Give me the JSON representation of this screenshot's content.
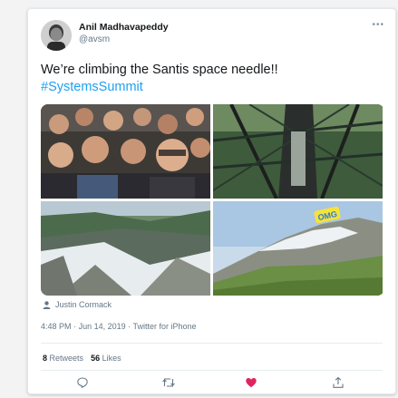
{
  "user": {
    "name": "Anil Madhavapeddy",
    "handle": "@avsm"
  },
  "menu_icon": "ellipsis-icon",
  "tweet": {
    "text": "We’re climbing the Santis space needle!!",
    "hashtag": "#SystemsSummit"
  },
  "media": {
    "items": [
      {
        "subject": "group selfie of people"
      },
      {
        "subject": "steel tower lattice interior"
      },
      {
        "subject": "snowy mountain valley"
      },
      {
        "subject": "mountain ridge",
        "overlay_text": "OMG"
      }
    ]
  },
  "photo_credit": {
    "icon": "person-icon",
    "name": "Justin Cormack"
  },
  "meta": {
    "time": "4:48 PM",
    "date": "Jun 14, 2019",
    "source": "Twitter for iPhone",
    "separator": "·"
  },
  "stats": {
    "retweets_count": "8",
    "retweets_label": "Retweets",
    "likes_count": "56",
    "likes_label": "Likes"
  },
  "actions": {
    "icons": [
      "reply-icon",
      "retweet-icon",
      "heart-icon",
      "share-icon"
    ],
    "liked_color": "#e0245e"
  },
  "colors": {
    "link": "#1da1f2",
    "secondary_text": "#657786",
    "primary_text": "#14171a",
    "like": "#e0245e"
  }
}
